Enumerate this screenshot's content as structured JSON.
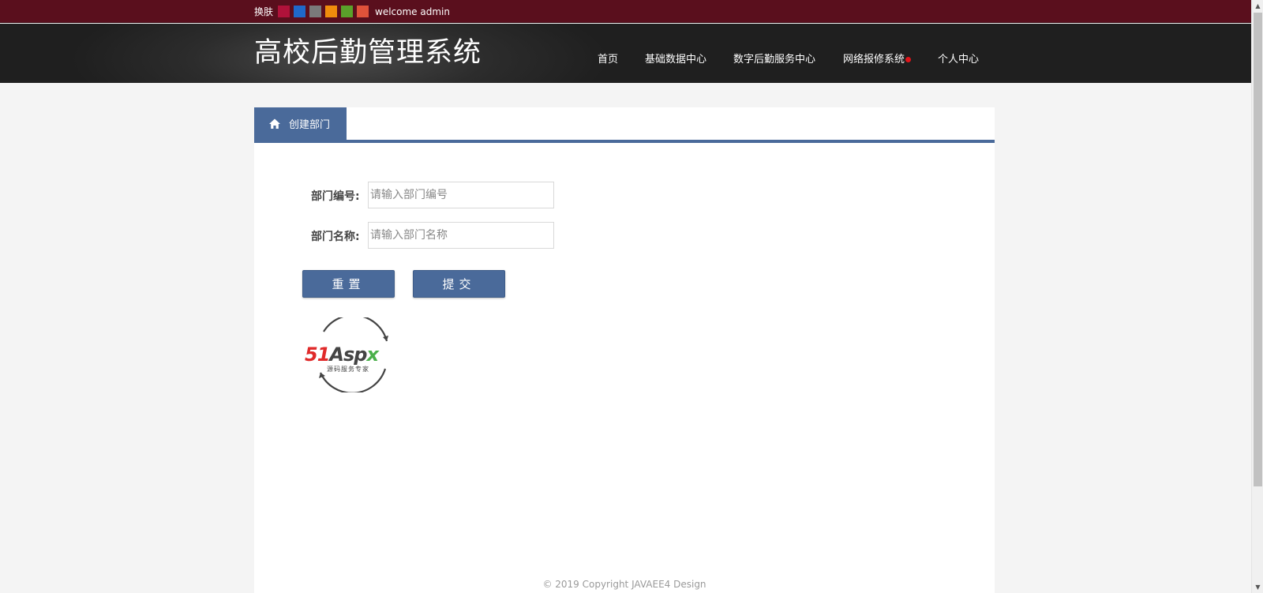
{
  "topbar": {
    "skin_label": "换肤",
    "skin_colors": [
      "#b0123a",
      "#1f68c9",
      "#7a7a7a",
      "#f08c0c",
      "#5aa12a",
      "#e0523a"
    ],
    "welcome": "welcome admin"
  },
  "header": {
    "title": "高校后勤管理系统",
    "nav": [
      "首页",
      "基础数据中心",
      "数字后勤服务中心",
      "网络报修系统",
      "个人中心"
    ]
  },
  "tab": {
    "label": "创建部门",
    "icon": "home-icon"
  },
  "form": {
    "fields": [
      {
        "label": "部门编号:",
        "placeholder": "请输入部门编号",
        "value": ""
      },
      {
        "label": "部门名称:",
        "placeholder": "请输入部门名称",
        "value": ""
      }
    ],
    "reset_label": "重置",
    "submit_label": "提交"
  },
  "logo": {
    "brand": "51Aspx",
    "tagline": "源码服务专家"
  },
  "footer": {
    "text": "© 2019 Copyright JAVAEE4 Design"
  },
  "colors": {
    "topbar": "#5a0f1d",
    "accent": "#4a6a9a",
    "notification_dot": "#e0141a"
  }
}
